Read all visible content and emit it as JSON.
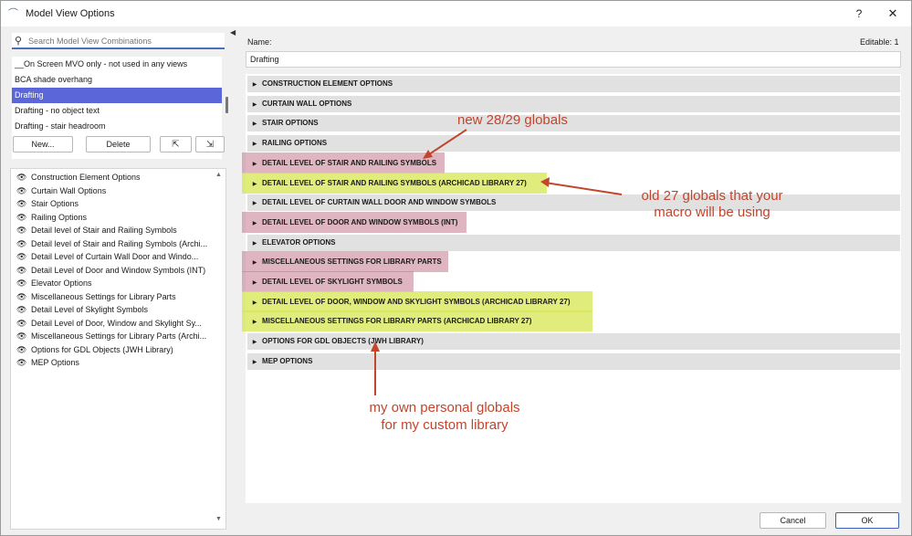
{
  "window": {
    "title": "Model View Options",
    "help": "?",
    "close": "✕"
  },
  "search": {
    "placeholder": "Search Model View Combinations",
    "value": ""
  },
  "combinations": [
    {
      "label": "__On Screen MVO only - not used in any views",
      "selected": false
    },
    {
      "label": "BCA shade overhang",
      "selected": false
    },
    {
      "label": "Drafting",
      "selected": true
    },
    {
      "label": "Drafting - no object text",
      "selected": false
    },
    {
      "label": "Drafting - stair headroom",
      "selected": false
    }
  ],
  "buttons": {
    "new": "New...",
    "delete": "Delete"
  },
  "option_sets": [
    "Construction Element Options",
    "Curtain Wall Options",
    "Stair Options",
    "Railing Options",
    "Detail level of Stair and Railing Symbols",
    "Detail level of Stair and Railing Symbols (Archi...",
    "Detail Level of Curtain Wall Door and Windo...",
    "Detail Level of Door and Window Symbols (INT)",
    "Elevator Options",
    "Miscellaneous Settings for Library Parts",
    "Detail Level of Skylight Symbols",
    "Detail Level of Door, Window and Skylight Sy...",
    "Miscellaneous Settings for Library Parts (Archi...",
    "Options for GDL Objects (JWH Library)",
    "MEP Options"
  ],
  "name": {
    "label": "Name:",
    "value": "Drafting",
    "editable": "Editable: 1"
  },
  "sections": [
    {
      "label": "CONSTRUCTION ELEMENT OPTIONS",
      "highlight": "none"
    },
    {
      "label": "CURTAIN WALL OPTIONS",
      "highlight": "none"
    },
    {
      "label": "STAIR OPTIONS",
      "highlight": "none"
    },
    {
      "label": "RAILING OPTIONS",
      "highlight": "none"
    },
    {
      "label": "DETAIL LEVEL OF STAIR AND RAILING SYMBOLS",
      "highlight": "red"
    },
    {
      "label": "DETAIL LEVEL OF STAIR AND RAILING SYMBOLS (ARCHICAD LIBRARY 27)",
      "highlight": "yellow"
    },
    {
      "label": "DETAIL LEVEL OF CURTAIN WALL DOOR AND WINDOW SYMBOLS",
      "highlight": "none"
    },
    {
      "label": "DETAIL LEVEL OF DOOR AND WINDOW SYMBOLS (INT)",
      "highlight": "red"
    },
    {
      "label": "ELEVATOR OPTIONS",
      "highlight": "none"
    },
    {
      "label": "MISCELLANEOUS SETTINGS FOR LIBRARY PARTS",
      "highlight": "red"
    },
    {
      "label": "DETAIL LEVEL OF SKYLIGHT SYMBOLS",
      "highlight": "red"
    },
    {
      "label": "DETAIL LEVEL OF DOOR, WINDOW AND SKYLIGHT SYMBOLS (ARCHICAD LIBRARY 27)",
      "highlight": "yellow"
    },
    {
      "label": "MISCELLANEOUS SETTINGS FOR LIBRARY PARTS (ARCHICAD LIBRARY 27)",
      "highlight": "yellow"
    },
    {
      "label": "OPTIONS FOR GDL OBJECTS (JWH LIBRARY)",
      "highlight": "none"
    },
    {
      "label": "MEP OPTIONS",
      "highlight": "none"
    }
  ],
  "annotations": {
    "new_globals": "new 28/29 globals",
    "old_globals_line1": "old 27 globals that your",
    "old_globals_line2": "macro will be using",
    "personal_line1": "my own personal globals",
    "personal_line2": "for my custom library"
  },
  "footer": {
    "cancel": "Cancel",
    "ok": "OK"
  },
  "colors": {
    "selection": "#5b67d9",
    "annotation": "#c2452d",
    "highlight_red": "#c3788c",
    "highlight_yellow": "#d6e650",
    "ok_border": "#3f60b8"
  }
}
